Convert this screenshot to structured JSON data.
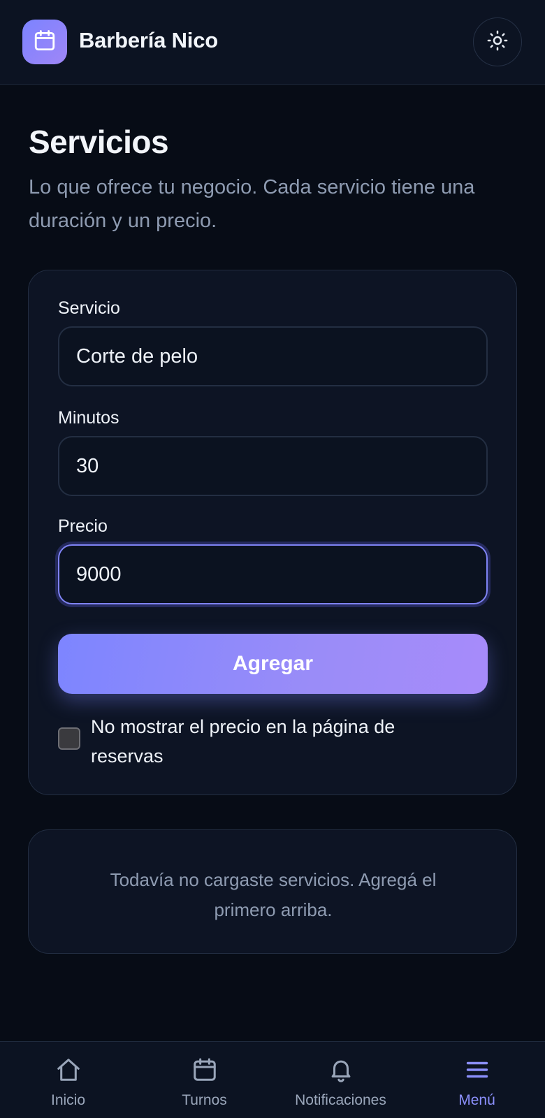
{
  "header": {
    "brand": "Barbería Nico",
    "logo_icon": "calendar-icon",
    "theme_icon": "sun-icon"
  },
  "page": {
    "title": "Servicios",
    "subtitle": "Lo que ofrece tu negocio. Cada servicio tiene una duración y un precio."
  },
  "form": {
    "service_label": "Servicio",
    "service_value": "Corte de pelo",
    "minutes_label": "Minutos",
    "minutes_value": "30",
    "price_label": "Precio",
    "price_value": "9000",
    "submit_label": "Agregar",
    "hide_price_label": "No mostrar el precio en la página de reservas",
    "hide_price_checked": false
  },
  "empty_state": {
    "text": "Todavía no cargaste servicios. Agregá el primero arriba."
  },
  "nav": {
    "items": [
      {
        "label": "Inicio",
        "icon": "home-icon",
        "active": false
      },
      {
        "label": "Turnos",
        "icon": "calendar-icon",
        "active": false
      },
      {
        "label": "Notificaciones",
        "icon": "bell-icon",
        "active": false
      },
      {
        "label": "Menú",
        "icon": "menu-icon",
        "active": true
      }
    ]
  },
  "colors": {
    "background": "#070c16",
    "surface": "#0d1424",
    "accent": "#7d85ff",
    "accent_end": "#a78bfa",
    "muted_text": "#8e9bb1",
    "active_nav": "#8b8ffb"
  }
}
